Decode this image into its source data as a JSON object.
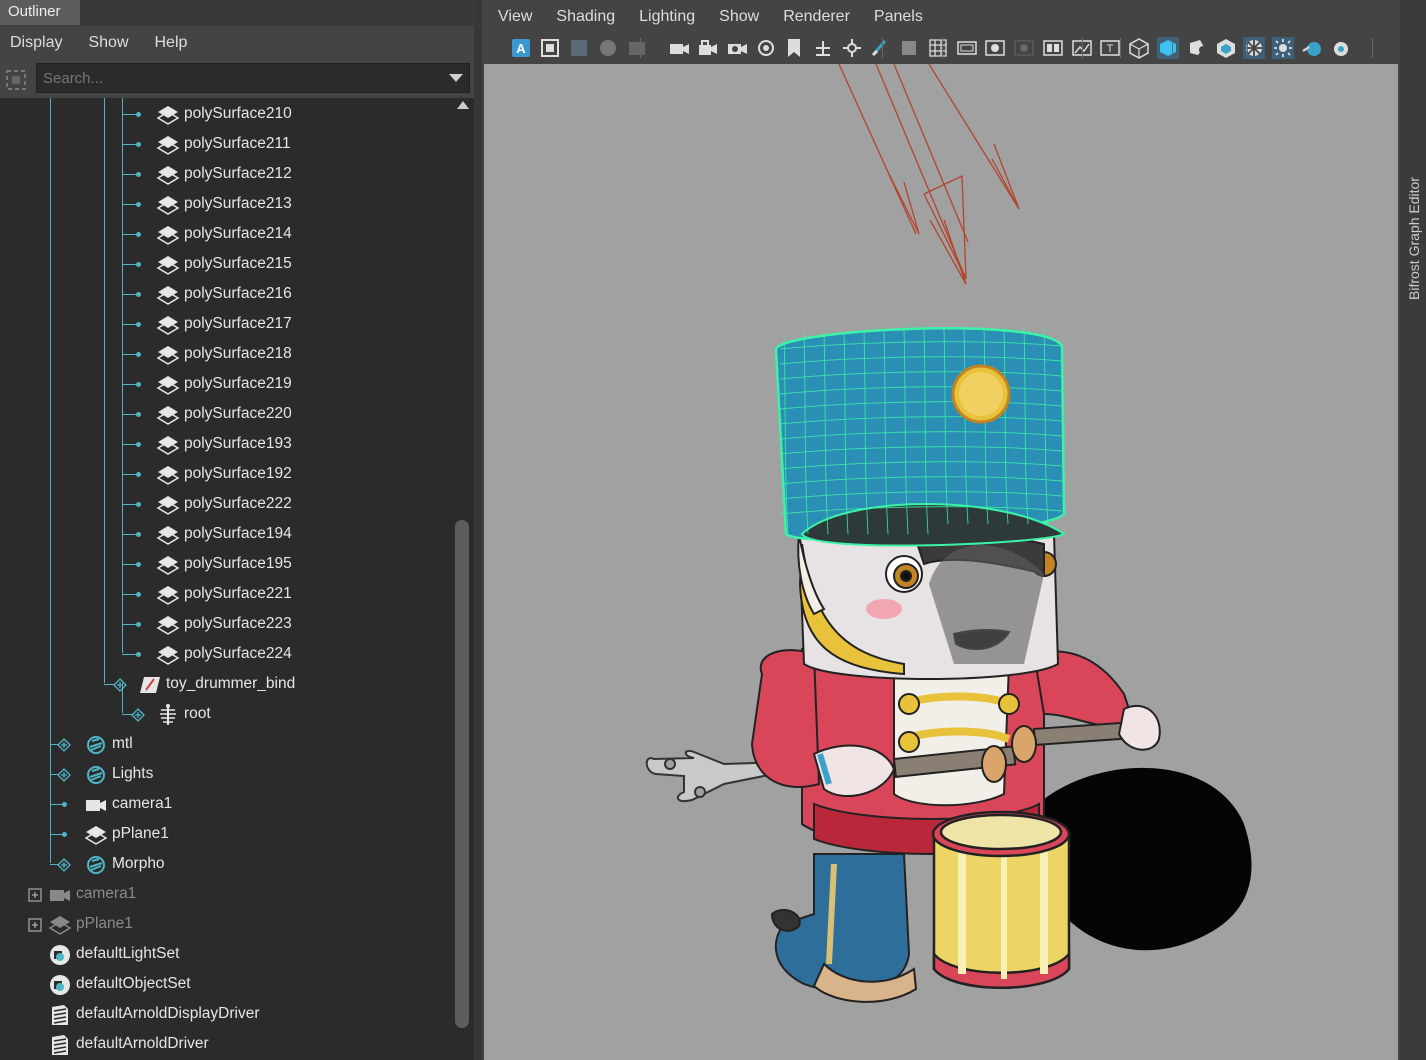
{
  "outliner": {
    "title": "Outliner",
    "menu": [
      "Display",
      "Show",
      "Help"
    ],
    "search_placeholder": "Search...",
    "tree": [
      {
        "label": "polySurface210",
        "icon": "mesh-icon"
      },
      {
        "label": "polySurface211",
        "icon": "mesh-icon"
      },
      {
        "label": "polySurface212",
        "icon": "mesh-icon"
      },
      {
        "label": "polySurface213",
        "icon": "mesh-icon"
      },
      {
        "label": "polySurface214",
        "icon": "mesh-icon"
      },
      {
        "label": "polySurface215",
        "icon": "mesh-icon"
      },
      {
        "label": "polySurface216",
        "icon": "mesh-icon"
      },
      {
        "label": "polySurface217",
        "icon": "mesh-icon"
      },
      {
        "label": "polySurface218",
        "icon": "mesh-icon"
      },
      {
        "label": "polySurface219",
        "icon": "mesh-icon"
      },
      {
        "label": "polySurface220",
        "icon": "mesh-icon"
      },
      {
        "label": "polySurface193",
        "icon": "mesh-icon"
      },
      {
        "label": "polySurface192",
        "icon": "mesh-icon"
      },
      {
        "label": "polySurface222",
        "icon": "mesh-icon"
      },
      {
        "label": "polySurface194",
        "icon": "mesh-icon"
      },
      {
        "label": "polySurface195",
        "icon": "mesh-icon"
      },
      {
        "label": "polySurface221",
        "icon": "mesh-icon"
      },
      {
        "label": "polySurface223",
        "icon": "mesh-icon"
      },
      {
        "label": "polySurface224",
        "icon": "mesh-icon"
      },
      {
        "label": "toy_drummer_bind",
        "icon": "bind-pose-icon"
      },
      {
        "label": "root",
        "icon": "joint-icon"
      },
      {
        "label": "mtl",
        "icon": "group-icon"
      },
      {
        "label": "Lights",
        "icon": "group-icon"
      },
      {
        "label": "camera1",
        "icon": "camera-icon"
      },
      {
        "label": "pPlane1",
        "icon": "mesh-icon"
      },
      {
        "label": "Morpho",
        "icon": "group-icon"
      },
      {
        "label": "camera1",
        "icon": "camera-icon"
      },
      {
        "label": "pPlane1",
        "icon": "mesh-icon"
      },
      {
        "label": "defaultLightSet",
        "icon": "set-icon"
      },
      {
        "label": "defaultObjectSet",
        "icon": "set-icon"
      },
      {
        "label": "defaultArnoldDisplayDriver",
        "icon": "arnold-driver-icon"
      },
      {
        "label": "defaultArnoldDriver",
        "icon": "arnold-driver-icon"
      }
    ]
  },
  "viewport": {
    "menu": [
      "View",
      "Shading",
      "Lighting",
      "Show",
      "Renderer",
      "Panels"
    ],
    "toolbar_icons": [
      "select-camera-icon",
      "camera-attributes-icon",
      "bookmarks-icon",
      "image-plane-icon",
      "2d-pan-zoom-icon",
      "grease-pencil-icon",
      "lock-camera-icon",
      "camera-settings-icon",
      "film-gate-icon",
      "resolution-gate-icon",
      "gate-mask-icon",
      "field-chart-icon",
      "safe-action-icon",
      "safe-title-icon",
      "grid-icon",
      "wireframe-icon",
      "smooth-shade-icon",
      "default-material-icon",
      "wireframe-on-shaded-icon",
      "xray-icon",
      "textured-icon",
      "use-all-lights-icon",
      "shadows-icon",
      "screen-space-ao-icon",
      "motion-blur-icon",
      "anti-aliasing-icon",
      "depth-of-field-icon",
      "isolate-select-icon",
      "xray-joints-icon"
    ],
    "background_color": "#a1a1a1"
  },
  "right_tab": {
    "label": "Bifrost Graph Editor"
  }
}
